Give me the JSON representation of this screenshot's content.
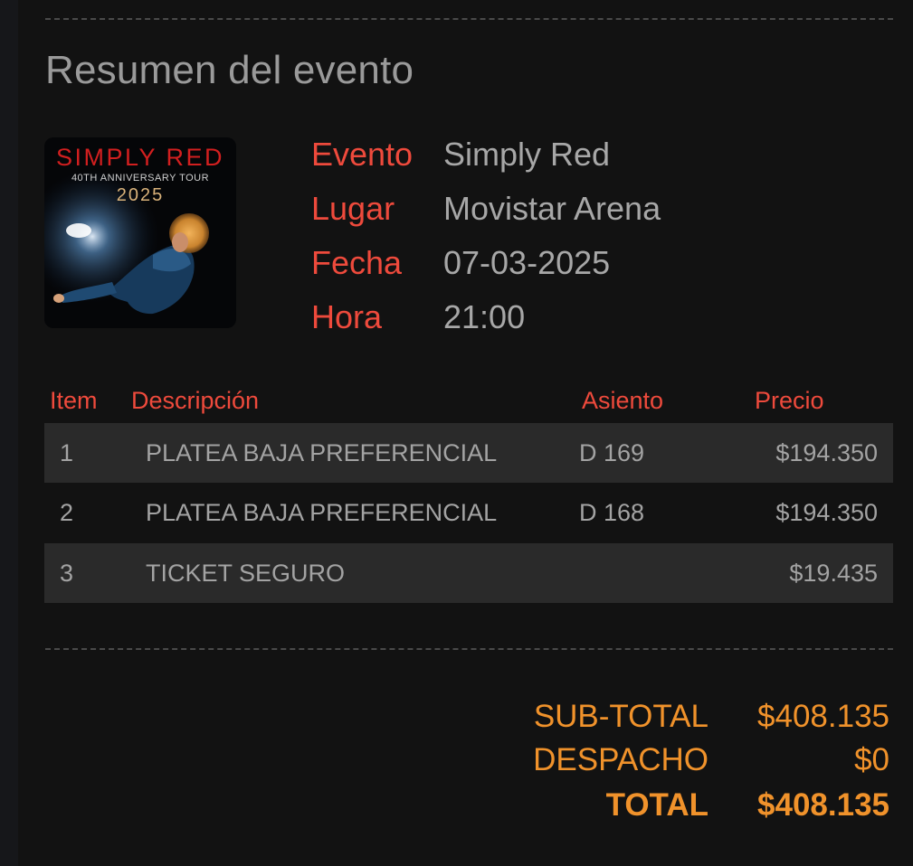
{
  "summary": {
    "title": "Resumen del evento"
  },
  "poster": {
    "band": "SIMPLY RED",
    "tour": "40TH ANNIVERSARY TOUR",
    "year": "2025"
  },
  "event_info": {
    "event_label": "Evento",
    "event_value": "Simply Red",
    "venue_label": "Lugar",
    "venue_value": "Movistar Arena",
    "date_label": "Fecha",
    "date_value": "07-03-2025",
    "time_label": "Hora",
    "time_value": "21:00"
  },
  "table": {
    "headers": {
      "item": "Item",
      "description": "Descripción",
      "seat": "Asiento",
      "price": "Precio"
    },
    "rows": [
      {
        "item": "1",
        "description": "PLATEA BAJA PREFERENCIAL",
        "seat": "D 169",
        "price": "$194.350"
      },
      {
        "item": "2",
        "description": "PLATEA BAJA PREFERENCIAL",
        "seat": "D 168",
        "price": "$194.350"
      },
      {
        "item": "3",
        "description": "TICKET SEGURO",
        "seat": "",
        "price": "$19.435"
      }
    ]
  },
  "totals": {
    "subtotal_label": "SUB-TOTAL",
    "subtotal_value": "$408.135",
    "shipping_label": "DESPACHO",
    "shipping_value": "$0",
    "total_label": "TOTAL",
    "total_value": "$408.135"
  },
  "colors": {
    "background": "#121212",
    "label_red": "#ee4a3c",
    "value_gray": "#a7a7a7",
    "total_orange": "#f0922b",
    "row_shade": "#2a2a2a"
  }
}
